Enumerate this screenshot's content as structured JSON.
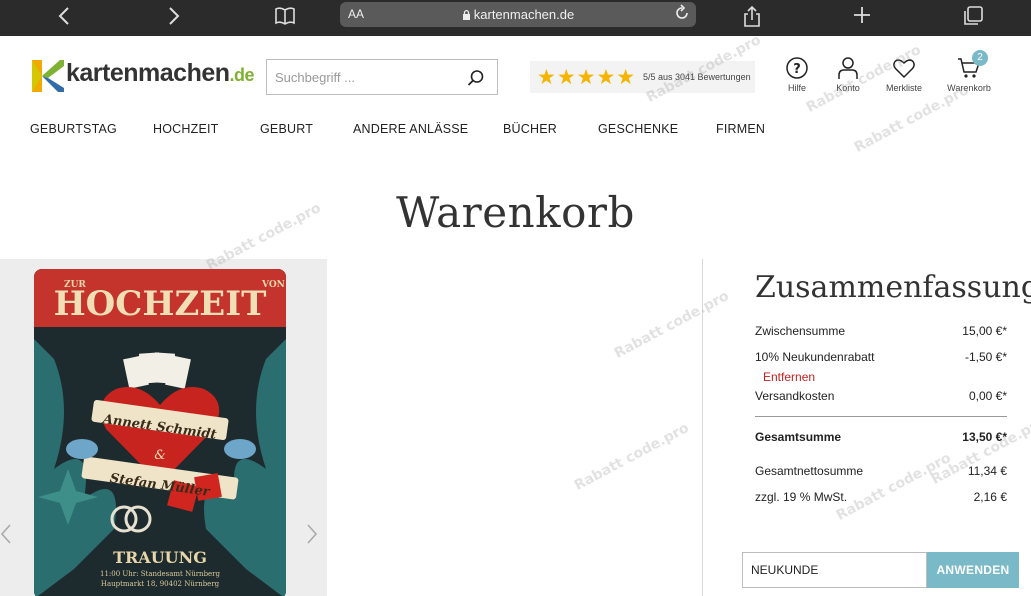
{
  "browser": {
    "back_icon": "chevron-left-icon",
    "forward_icon": "chevron-right-icon",
    "reader_label": "AA",
    "url": "kartenmachen.de",
    "lock_icon": "lock-icon",
    "reload_icon": "reload-icon"
  },
  "logo": {
    "name": "kartenmachen",
    "tld": ".de"
  },
  "search": {
    "placeholder": "Suchbegriff ..."
  },
  "rating": {
    "stars": "★★★★★",
    "text": "5/5 aus 3041 Bewertungen"
  },
  "header_icons": {
    "help": "Hilfe",
    "account": "Konto",
    "wishlist": "Merkliste",
    "cart": "Warenkorb",
    "cart_count": "2"
  },
  "nav": [
    "GEBURTSTAG",
    "HOCHZEIT",
    "GEBURT",
    "ANDERE ANLÄSSE",
    "BÜCHER",
    "GESCHENKE",
    "FIRMEN"
  ],
  "page_title": "Warenkorb",
  "product": {
    "card_heading": "HOCHZEIT",
    "card_side_left": "ZUR",
    "card_side_right": "VON",
    "name1": "Annett Schmidt",
    "amp": "&",
    "name2": "Stefan Müller",
    "event": "TRAUUNG",
    "line1": "11:00 Uhr: Standesamt Nürnberg",
    "line2": "Hauptmarkt 18, 90402 Nürnberg",
    "prev_icon": "chevron-left-icon",
    "next_icon": "chevron-right-icon"
  },
  "summary": {
    "title": "Zusammenfassung",
    "rows": [
      {
        "label": "Zwischensumme",
        "value": "15,00 €*"
      },
      {
        "label": "10% Neukundenrabatt",
        "value": "-1,50 €*"
      },
      {
        "label": "Versandkosten",
        "value": "0,00 €*"
      }
    ],
    "remove_label": "Entfernen",
    "total_label": "Gesamtsumme",
    "total_value": "13,50 €*",
    "net_label": "Gesamtnettosumme",
    "net_value": "11,34 €",
    "tax_label": "zzgl. 19 % MwSt.",
    "tax_value": "2,16 €"
  },
  "coupon": {
    "value": "NEUKUNDE",
    "button": "ANWENDEN"
  },
  "watermark": "Rabatt code.pro",
  "colors": {
    "accent": "#7ab9c8",
    "link_red": "#c0201f",
    "star": "#f5b400",
    "logo_green": "#7fb132"
  }
}
